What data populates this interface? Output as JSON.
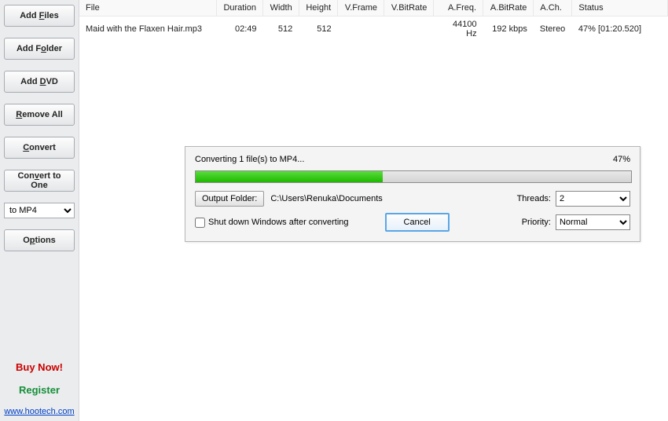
{
  "sidebar": {
    "add_files": "Add Files",
    "add_folder": "Add Folder",
    "add_dvd": "Add DVD",
    "remove_all": "Remove All",
    "convert": "Convert",
    "convert_to_one": "Convert to One",
    "format": "to MP4",
    "options": "Options",
    "buy_now": "Buy Now!",
    "register": "Register",
    "site_link": "www.hootech.com"
  },
  "columns": {
    "file": "File",
    "duration": "Duration",
    "width": "Width",
    "height": "Height",
    "vframe": "V.Frame",
    "vbitrate": "V.BitRate",
    "afreq": "A.Freq.",
    "abitrate": "A.BitRate",
    "ach": "A.Ch.",
    "status": "Status"
  },
  "row": {
    "file": "Maid with the Flaxen Hair.mp3",
    "duration": "02:49",
    "width": "512",
    "height": "512",
    "vframe": "",
    "vbitrate": "",
    "afreq": "44100 Hz",
    "abitrate": "192 kbps",
    "ach": "Stereo",
    "status": "47% [01:20.520]"
  },
  "dialog": {
    "label": "Converting 1 file(s) to MP4...",
    "percent": "47%",
    "out_btn": "Output Folder:",
    "path": "C:\\Users\\Renuka\\Documents",
    "threads_label": "Threads:",
    "threads_value": "2",
    "shutdown": "Shut down Windows after converting",
    "cancel": "Cancel",
    "priority_label": "Priority:",
    "priority_value": "Normal"
  }
}
